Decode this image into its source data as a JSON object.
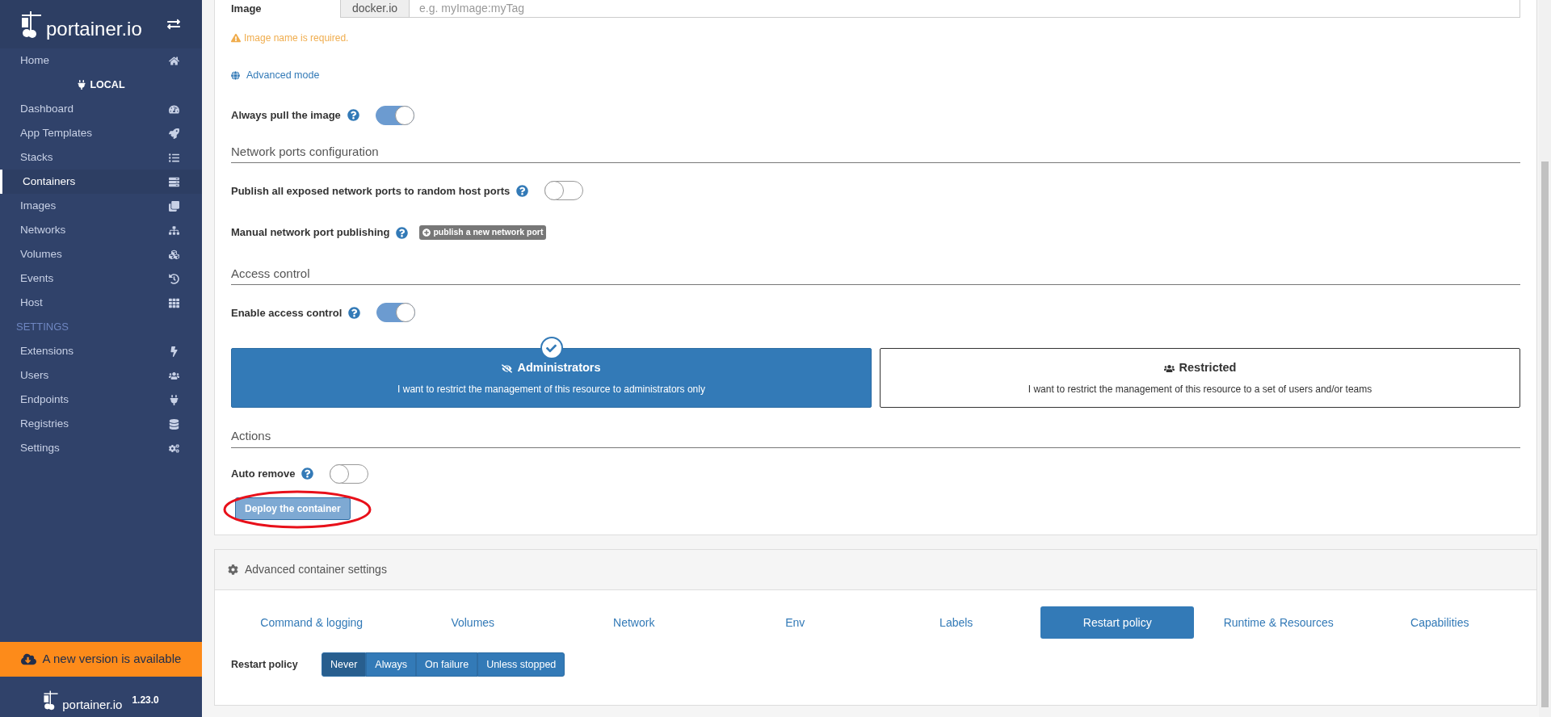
{
  "sidebar": {
    "logo": "portainer.io",
    "items": [
      {
        "kind": "link",
        "label": "Home",
        "selected": false
      },
      {
        "kind": "endpoint",
        "label": "LOCAL"
      },
      {
        "kind": "link",
        "label": "Dashboard",
        "selected": false
      },
      {
        "kind": "link",
        "label": "App Templates",
        "selected": false
      },
      {
        "kind": "link",
        "label": "Stacks",
        "selected": false
      },
      {
        "kind": "link",
        "label": "Containers",
        "selected": true
      },
      {
        "kind": "link",
        "label": "Images",
        "selected": false
      },
      {
        "kind": "link",
        "label": "Networks",
        "selected": false
      },
      {
        "kind": "link",
        "label": "Volumes",
        "selected": false
      },
      {
        "kind": "link",
        "label": "Events",
        "selected": false
      },
      {
        "kind": "link",
        "label": "Host",
        "selected": false
      },
      {
        "kind": "heading",
        "label": "SETTINGS"
      },
      {
        "kind": "link",
        "label": "Extensions",
        "selected": false
      },
      {
        "kind": "link",
        "label": "Users",
        "selected": false
      },
      {
        "kind": "link",
        "label": "Endpoints",
        "selected": false
      },
      {
        "kind": "link",
        "label": "Registries",
        "selected": false
      },
      {
        "kind": "link",
        "label": "Settings",
        "selected": false
      }
    ],
    "update_banner": "A new version is available",
    "footer_logo": "portainer.io",
    "version": "1.23.0"
  },
  "image": {
    "label": "Image",
    "registry": "docker.io",
    "placeholder": "e.g. myImage:myTag",
    "error": "Image name is required.",
    "advanced_link": "Advanced mode"
  },
  "always_pull": {
    "label": "Always pull the image",
    "on": true
  },
  "network": {
    "heading": "Network ports configuration",
    "publish_all": {
      "label": "Publish all exposed network ports to random host ports",
      "on": false
    },
    "manual": {
      "label": "Manual network port publishing",
      "button": "publish a new network port"
    }
  },
  "access": {
    "heading": "Access control",
    "enable": {
      "label": "Enable access control",
      "on": true
    },
    "options": [
      {
        "title": "Administrators",
        "description": "I want to restrict the management of this resource to administrators only",
        "selected": true
      },
      {
        "title": "Restricted",
        "description": "I want to restrict the management of this resource to a set of users and/or teams",
        "selected": false
      }
    ]
  },
  "actions": {
    "heading": "Actions",
    "auto_remove": {
      "label": "Auto remove",
      "on": false
    },
    "deploy_button": "Deploy the container",
    "deploy_disabled": true
  },
  "advanced": {
    "title": "Advanced container settings",
    "tabs": [
      {
        "label": "Command & logging",
        "selected": false
      },
      {
        "label": "Volumes",
        "selected": false
      },
      {
        "label": "Network",
        "selected": false
      },
      {
        "label": "Env",
        "selected": false
      },
      {
        "label": "Labels",
        "selected": false
      },
      {
        "label": "Restart policy",
        "selected": true
      },
      {
        "label": "Runtime & Resources",
        "selected": false
      },
      {
        "label": "Capabilities",
        "selected": false
      }
    ],
    "restart_policy": {
      "label": "Restart policy",
      "options": [
        {
          "label": "Never",
          "selected": true
        },
        {
          "label": "Always",
          "selected": false
        },
        {
          "label": "On failure",
          "selected": false
        },
        {
          "label": "Unless stopped",
          "selected": false
        }
      ]
    }
  }
}
